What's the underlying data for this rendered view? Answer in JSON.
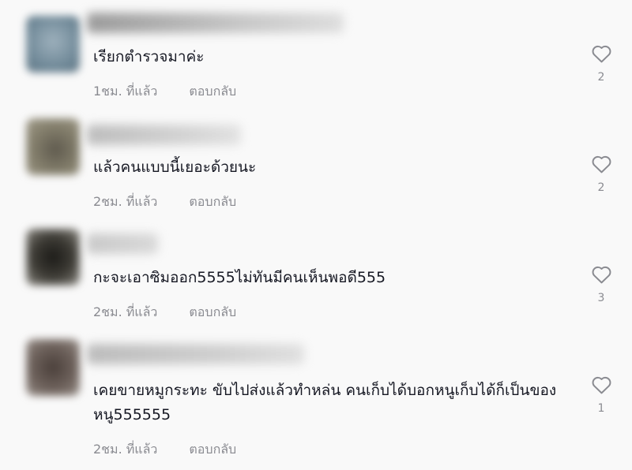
{
  "comments": [
    {
      "text": "เรียกตำรวจมาค่ะ",
      "time": "1ชม. ที่แล้ว",
      "reply": "ตอบกลับ",
      "likes": "2",
      "avatar_color": "#6f8897"
    },
    {
      "text": "แล้วคนแบบนี้เยอะด้วยนะ",
      "time": "2ชม. ที่แล้ว",
      "reply": "ตอบกลับ",
      "likes": "2",
      "avatar_color": "#85806d"
    },
    {
      "text": "กะจะเอาซิมออก5555ไม่ทันมีคนเห็นพอดี555",
      "time": "2ชม. ที่แล้ว",
      "reply": "ตอบกลับ",
      "likes": "3",
      "avatar_color": "#3d3b35"
    },
    {
      "text": "เคยขายหมูกระทะ ขับไปส่งแล้วทำหล่น คนเก็บได้บอกหนูเก็บได้ก็เป็นของหนู555555",
      "time": "2ชม. ที่แล้ว",
      "reply": "ตอบกลับ",
      "likes": "1",
      "avatar_color": "#6e625c"
    }
  ]
}
